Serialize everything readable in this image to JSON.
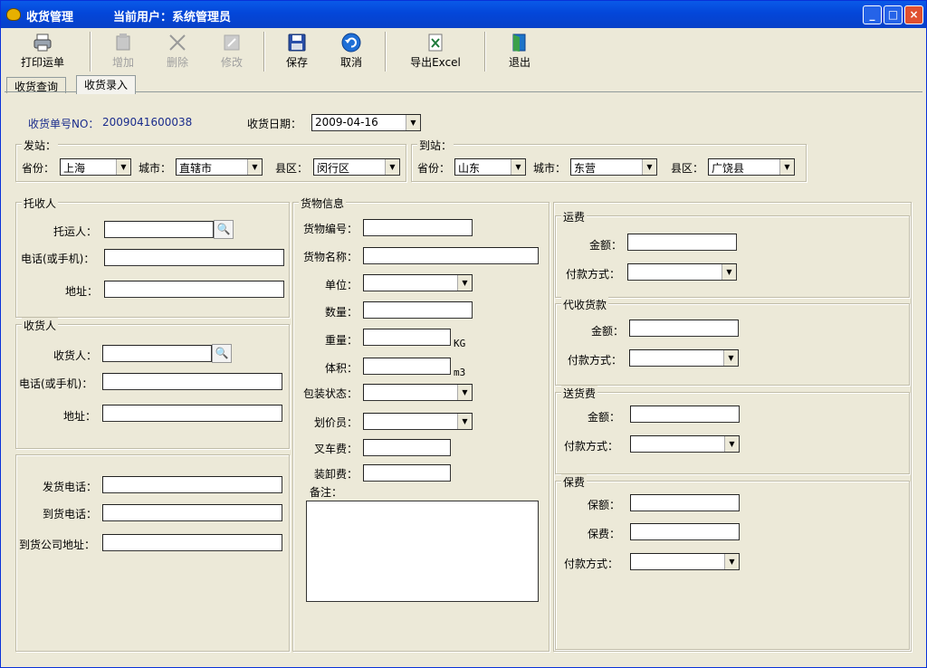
{
  "window": {
    "title": "收货管理",
    "user_label": "当前用户：系统管理员",
    "controls": {
      "min": "_",
      "max": "□",
      "close": "×"
    }
  },
  "toolbar": {
    "print": "打印运单",
    "add": "增加",
    "delete": "删除",
    "edit": "修改",
    "save": "保存",
    "cancel": "取消",
    "export": "导出Excel",
    "exit": "退出"
  },
  "tabs": {
    "query": "收货查询",
    "entry": "收货录入"
  },
  "header": {
    "order_no_label": "收货单号NO：",
    "order_no_value": "2009041600038",
    "date_label": "收货日期：",
    "date_value": "2009-04-16"
  },
  "origin": {
    "title": "发站：",
    "province_label": "省份：",
    "province_value": "上海",
    "city_label": "城市：",
    "city_value": "直辖市",
    "district_label": "县区：",
    "district_value": "闵行区"
  },
  "destination": {
    "title": "到站：",
    "province_label": "省份：",
    "province_value": "山东",
    "city_label": "城市：",
    "city_value": "东营",
    "district_label": "县区：",
    "district_value": "广饶县"
  },
  "shipper": {
    "title": "托收人",
    "name_label": "托运人：",
    "phone_label": "电话(或手机)：",
    "address_label": "地址："
  },
  "receiver": {
    "title": "收货人",
    "name_label": "收货人：",
    "phone_label": "电话(或手机)：",
    "address_label": "地址："
  },
  "contact": {
    "send_phone_label": "发货电话：",
    "arrive_phone_label": "到货电话：",
    "arrive_address_label": "到货公司地址："
  },
  "goods": {
    "title": "货物信息",
    "code_label": "货物编号：",
    "name_label": "货物名称：",
    "unit_label": "单位：",
    "qty_label": "数量：",
    "weight_label": "重量：",
    "weight_unit": "KG",
    "volume_label": "体积：",
    "volume_unit": "m3",
    "pack_label": "包装状态：",
    "pricer_label": "划价员：",
    "forklift_label": "叉车费：",
    "loading_label": "装卸费：",
    "note_label": "备注："
  },
  "freight": {
    "title": "运费",
    "amount_label": "金额：",
    "pay_label": "付款方式："
  },
  "cod": {
    "title": "代收货款",
    "amount_label": "金额：",
    "pay_label": "付款方式："
  },
  "delivery": {
    "title": "送货费",
    "amount_label": "金额：",
    "pay_label": "付款方式："
  },
  "insurance": {
    "title": "保费",
    "insured_label": "保额：",
    "premium_label": "保费：",
    "pay_label": "付款方式："
  }
}
